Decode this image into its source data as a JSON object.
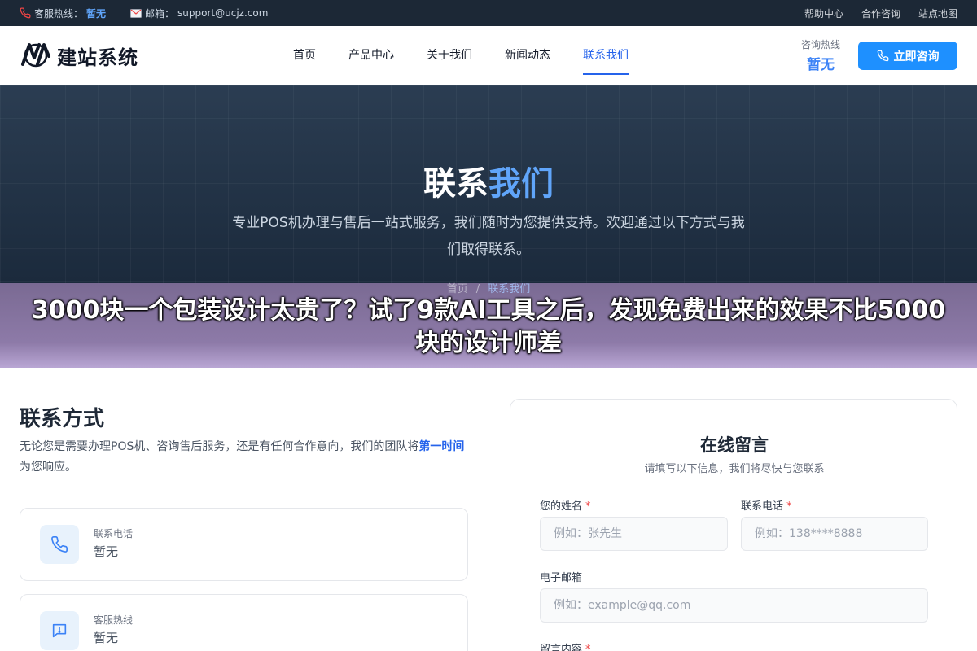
{
  "topbar": {
    "hotline_label": "客服热线：",
    "hotline_value": "暂无",
    "email_label": "邮箱：",
    "email_value": "support@ucjz.com",
    "links": [
      "帮助中心",
      "合作咨询",
      "站点地图"
    ]
  },
  "header": {
    "logo_text": "建站系统",
    "nav": [
      "首页",
      "产品中心",
      "关于我们",
      "新闻动态",
      "联系我们"
    ],
    "active_nav": "联系我们",
    "hotline_label": "咨询热线",
    "hotline_value": "暂无",
    "consult_button": "立即咨询"
  },
  "hero": {
    "title_main": "联系",
    "title_accent": "我们",
    "description": "专业POS机办理与售后一站式服务，我们随时为您提供支持。欢迎通过以下方式与我们取得联系。",
    "breadcrumb": [
      "首页",
      "/",
      "联系我们"
    ]
  },
  "overlay": {
    "headline": "3000块一个包装设计太贵了？试了9款AI工具之后，发现免费出来的效果不比5000块的设计师差"
  },
  "contact": {
    "heading": "联系方式",
    "intro_before": "无论您是需要办理POS机、咨询售后服务，还是有任何合作意向，我们的团队将",
    "intro_emphasis": "第一时间",
    "intro_after": "为您响应。",
    "cards": [
      {
        "label": "联系电话",
        "value": "暂无",
        "icon": "phone-icon"
      },
      {
        "label": "客服热线",
        "value": "暂无",
        "icon": "message-icon"
      }
    ]
  },
  "form": {
    "title": "在线留言",
    "subtitle": "请填写以下信息，我们将尽快与您联系",
    "name_label": "您的姓名",
    "name_placeholder": "例如：张先生",
    "phone_label": "联系电话",
    "phone_placeholder": "例如：138****8888",
    "email_label": "电子邮箱",
    "email_placeholder": "例如：example@qq.com",
    "message_label": "留言内容",
    "required_mark": "*"
  },
  "colors": {
    "primary": "#1e90ff",
    "topbar_bg": "#1c2836",
    "hero_bg": "#1b2a3c",
    "accent_text": "#2563eb"
  }
}
